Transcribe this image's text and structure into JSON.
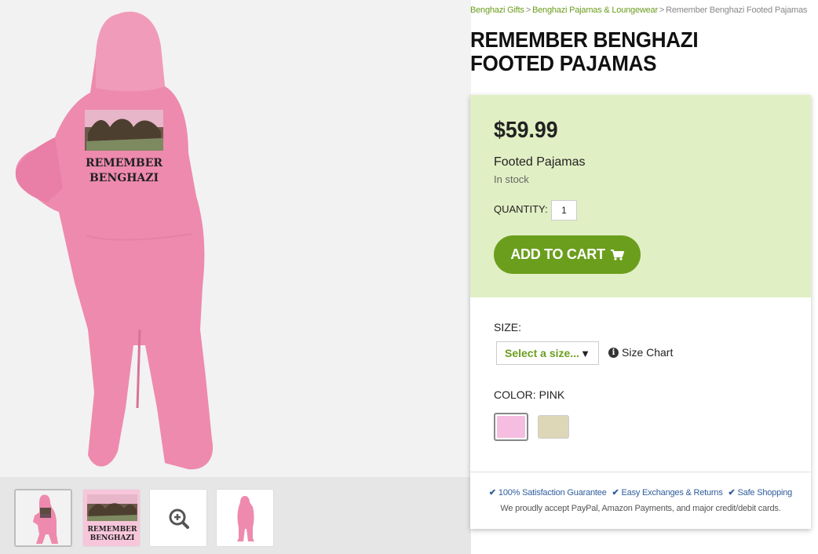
{
  "breadcrumb": {
    "items": [
      "Benghazi Gifts",
      "Benghazi Pajamas & Loungewear"
    ],
    "current": "Remember Benghazi Footed Pajamas",
    "separator": ">"
  },
  "product": {
    "title": "REMEMBER BENGHAZI FOOTED PAJAMAS",
    "price": "$59.99",
    "type": "Footed Pajamas",
    "stock": "In stock",
    "print_text_line1": "REMEMBER",
    "print_text_line2": "BENGHAZI"
  },
  "quantity": {
    "label": "QUANTITY:",
    "value": "1"
  },
  "cart": {
    "button_label": "ADD TO CART",
    "icon": "shopping-cart-icon"
  },
  "size": {
    "label": "SIZE:",
    "placeholder": "Select a size...",
    "chart_label": "Size Chart"
  },
  "color": {
    "label": "COLOR: PINK",
    "options": [
      "pink",
      "tan"
    ],
    "swatch_colors": [
      "#f5bde0",
      "#ddd7b7"
    ]
  },
  "thumbnails": {
    "print_line1": "REMEMBER",
    "print_line2": "BENGHAZI",
    "zoom_icon": "zoom-in-icon"
  },
  "footer": {
    "guarantees": [
      "100% Satisfaction Guarantee",
      "Easy Exchanges & Returns",
      "Safe Shopping"
    ],
    "payments": "We proudly accept PayPal, Amazon Payments, and major credit/debit cards."
  },
  "colors": {
    "accent": "#6b9e1d",
    "panel": "#e1efc4",
    "pajama": "#ee8aae",
    "link": "#2f5d9c"
  }
}
